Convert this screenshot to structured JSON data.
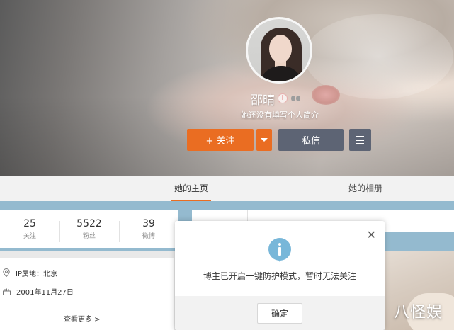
{
  "profile": {
    "name": "邵晴",
    "bio": "她还没有填写个人简介",
    "badge_icon": "i"
  },
  "actions": {
    "follow_label": "+ 关注",
    "message_label": "私信"
  },
  "tabs": [
    {
      "label": "她的主页",
      "active": true
    },
    {
      "label": "她的相册",
      "active": false
    }
  ],
  "stats": [
    {
      "value": "25",
      "label": "关注"
    },
    {
      "value": "5522",
      "label": "粉丝"
    },
    {
      "value": "39",
      "label": "微博"
    }
  ],
  "info": {
    "location": "IP属地：北京",
    "birthday": "2001年11月27日",
    "more_label": "查看更多 >"
  },
  "dialog": {
    "message": "博主已开启一键防护模式，暂时无法关注",
    "confirm_label": "确定",
    "close_glyph": "✕"
  },
  "watermark": "八怪娱",
  "colors": {
    "accent": "#ea6d22",
    "secondary_button": "#5d6474",
    "info_blue": "#78b7d9",
    "band_blue": "#94bacf"
  }
}
